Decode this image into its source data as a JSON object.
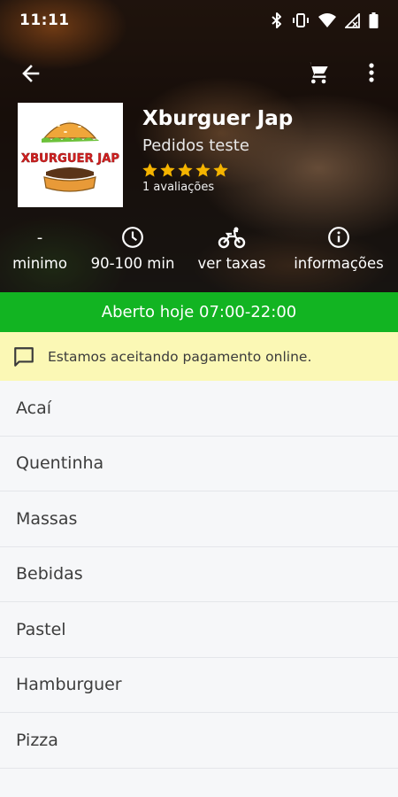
{
  "status_bar": {
    "time": "11:11",
    "icons": [
      "bluetooth-icon",
      "vibrate-icon",
      "wifi-icon",
      "signal-icon",
      "battery-icon"
    ]
  },
  "toolbar": {
    "back_icon": "arrow-back-icon",
    "cart_icon": "cart-icon",
    "more_icon": "more-vert-icon"
  },
  "store": {
    "logo_text": "XBURGUER JAP",
    "name": "Xburguer Jap",
    "subtitle": "Pedidos teste",
    "rating": 5,
    "rating_max": 5,
    "reviews": "1 avaliações"
  },
  "info": [
    {
      "icon": "dash",
      "value": "-",
      "label": "minimo"
    },
    {
      "icon": "clock-icon",
      "label": "90-100 min"
    },
    {
      "icon": "motorcycle-icon",
      "label": "ver taxas"
    },
    {
      "icon": "info-icon",
      "label": "informações"
    }
  ],
  "open_hours": "Aberto hoje 07:00-22:00",
  "notice": {
    "icon": "message-icon",
    "text": "Estamos aceitando pagamento online."
  },
  "categories": [
    "Acaí",
    "Quentinha",
    "Massas",
    "Bebidas",
    "Pastel",
    "Hamburguer",
    "Pizza"
  ],
  "colors": {
    "open_bar": "#12b422",
    "notice_bg": "#fbf8b5",
    "star": "#f5b400",
    "background": "#f6f7f9"
  }
}
